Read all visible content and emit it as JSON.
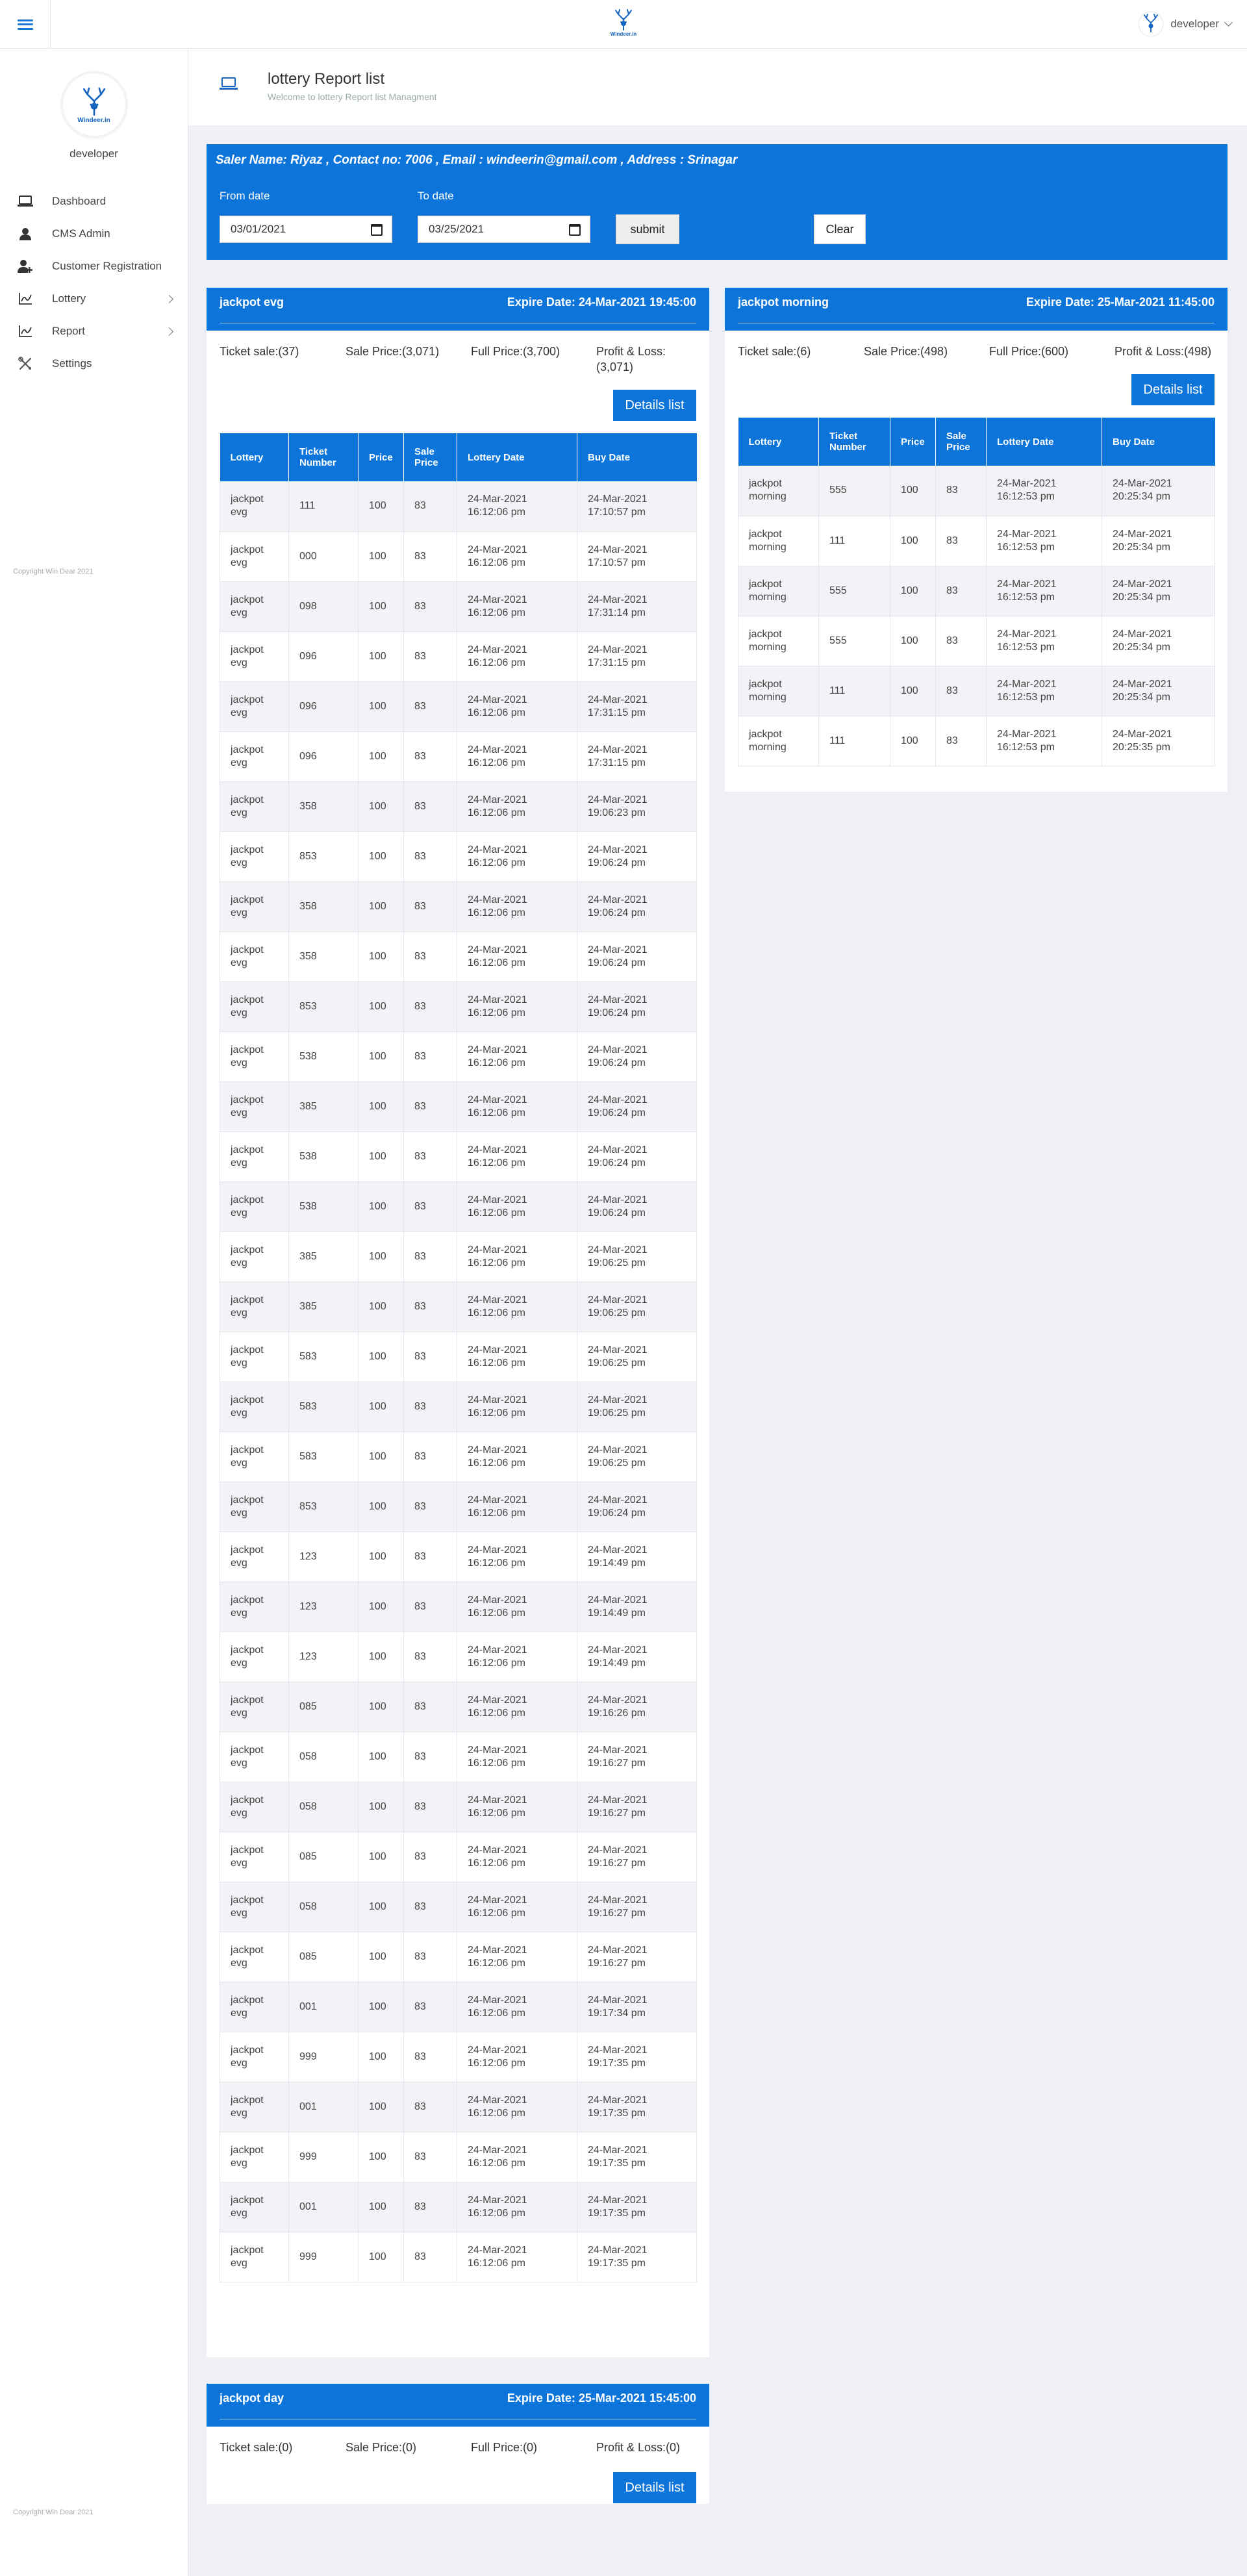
{
  "topbar": {
    "logo_text": "Windeer.in",
    "user_name": "developer"
  },
  "sidebar": {
    "logo_text": "Windeer.in",
    "profile_name": "developer",
    "items": [
      {
        "label": "Dashboard",
        "icon": "laptop-icon"
      },
      {
        "label": "CMS Admin",
        "icon": "user-icon"
      },
      {
        "label": "Customer Registration",
        "icon": "user-add-icon"
      },
      {
        "label": "Lottery",
        "icon": "chart-icon",
        "has_submenu": true
      },
      {
        "label": "Report",
        "icon": "chart-icon",
        "has_submenu": true
      },
      {
        "label": "Settings",
        "icon": "tools-icon"
      }
    ],
    "copyright": "Copyright Win Dear 2021"
  },
  "header": {
    "title": "lottery Report list",
    "subtitle": "Welcome to lottery Report list Managment"
  },
  "filter": {
    "saler_info": "Saler Name: Riyaz , Contact no: 7006 , Email : windeerin@gmail.com , Address : Srinagar",
    "from_label": "From date",
    "from_value": "03/01/2021",
    "to_label": "To date",
    "to_value": "03/25/2021",
    "submit_label": "submit",
    "clear_label": "Clear"
  },
  "table_headers": [
    "Lottery",
    "Ticket Number",
    "Price",
    "Sale Price",
    "Lottery Date",
    "Buy Date"
  ],
  "details_label": "Details list",
  "cards": [
    {
      "name": "jackpot evg",
      "expire": "Expire Date: 24-Mar-2021 19:45:00",
      "ticket_sale": "Ticket sale:(37)",
      "sale_price": "Sale Price:(3,071)",
      "full_price": "Full Price:(3,700)",
      "profit_loss": "Profit & Loss:(3,071)",
      "rows": [
        [
          "jackpot evg",
          "111",
          "100",
          "83",
          "24-Mar-2021 16:12:06 pm",
          "24-Mar-2021 17:10:57 pm"
        ],
        [
          "jackpot evg",
          "000",
          "100",
          "83",
          "24-Mar-2021 16:12:06 pm",
          "24-Mar-2021 17:10:57 pm"
        ],
        [
          "jackpot evg",
          "098",
          "100",
          "83",
          "24-Mar-2021 16:12:06 pm",
          "24-Mar-2021 17:31:14 pm"
        ],
        [
          "jackpot evg",
          "096",
          "100",
          "83",
          "24-Mar-2021 16:12:06 pm",
          "24-Mar-2021 17:31:15 pm"
        ],
        [
          "jackpot evg",
          "096",
          "100",
          "83",
          "24-Mar-2021 16:12:06 pm",
          "24-Mar-2021 17:31:15 pm"
        ],
        [
          "jackpot evg",
          "096",
          "100",
          "83",
          "24-Mar-2021 16:12:06 pm",
          "24-Mar-2021 17:31:15 pm"
        ],
        [
          "jackpot evg",
          "358",
          "100",
          "83",
          "24-Mar-2021 16:12:06 pm",
          "24-Mar-2021 19:06:23 pm"
        ],
        [
          "jackpot evg",
          "853",
          "100",
          "83",
          "24-Mar-2021 16:12:06 pm",
          "24-Mar-2021 19:06:24 pm"
        ],
        [
          "jackpot evg",
          "358",
          "100",
          "83",
          "24-Mar-2021 16:12:06 pm",
          "24-Mar-2021 19:06:24 pm"
        ],
        [
          "jackpot evg",
          "358",
          "100",
          "83",
          "24-Mar-2021 16:12:06 pm",
          "24-Mar-2021 19:06:24 pm"
        ],
        [
          "jackpot evg",
          "853",
          "100",
          "83",
          "24-Mar-2021 16:12:06 pm",
          "24-Mar-2021 19:06:24 pm"
        ],
        [
          "jackpot evg",
          "538",
          "100",
          "83",
          "24-Mar-2021 16:12:06 pm",
          "24-Mar-2021 19:06:24 pm"
        ],
        [
          "jackpot evg",
          "385",
          "100",
          "83",
          "24-Mar-2021 16:12:06 pm",
          "24-Mar-2021 19:06:24 pm"
        ],
        [
          "jackpot evg",
          "538",
          "100",
          "83",
          "24-Mar-2021 16:12:06 pm",
          "24-Mar-2021 19:06:24 pm"
        ],
        [
          "jackpot evg",
          "538",
          "100",
          "83",
          "24-Mar-2021 16:12:06 pm",
          "24-Mar-2021 19:06:24 pm"
        ],
        [
          "jackpot evg",
          "385",
          "100",
          "83",
          "24-Mar-2021 16:12:06 pm",
          "24-Mar-2021 19:06:25 pm"
        ],
        [
          "jackpot evg",
          "385",
          "100",
          "83",
          "24-Mar-2021 16:12:06 pm",
          "24-Mar-2021 19:06:25 pm"
        ],
        [
          "jackpot evg",
          "583",
          "100",
          "83",
          "24-Mar-2021 16:12:06 pm",
          "24-Mar-2021 19:06:25 pm"
        ],
        [
          "jackpot evg",
          "583",
          "100",
          "83",
          "24-Mar-2021 16:12:06 pm",
          "24-Mar-2021 19:06:25 pm"
        ],
        [
          "jackpot evg",
          "583",
          "100",
          "83",
          "24-Mar-2021 16:12:06 pm",
          "24-Mar-2021 19:06:25 pm"
        ],
        [
          "jackpot evg",
          "853",
          "100",
          "83",
          "24-Mar-2021 16:12:06 pm",
          "24-Mar-2021 19:06:24 pm"
        ],
        [
          "jackpot evg",
          "123",
          "100",
          "83",
          "24-Mar-2021 16:12:06 pm",
          "24-Mar-2021 19:14:49 pm"
        ],
        [
          "jackpot evg",
          "123",
          "100",
          "83",
          "24-Mar-2021 16:12:06 pm",
          "24-Mar-2021 19:14:49 pm"
        ],
        [
          "jackpot evg",
          "123",
          "100",
          "83",
          "24-Mar-2021 16:12:06 pm",
          "24-Mar-2021 19:14:49 pm"
        ],
        [
          "jackpot evg",
          "085",
          "100",
          "83",
          "24-Mar-2021 16:12:06 pm",
          "24-Mar-2021 19:16:26 pm"
        ],
        [
          "jackpot evg",
          "058",
          "100",
          "83",
          "24-Mar-2021 16:12:06 pm",
          "24-Mar-2021 19:16:27 pm"
        ],
        [
          "jackpot evg",
          "058",
          "100",
          "83",
          "24-Mar-2021 16:12:06 pm",
          "24-Mar-2021 19:16:27 pm"
        ],
        [
          "jackpot evg",
          "085",
          "100",
          "83",
          "24-Mar-2021 16:12:06 pm",
          "24-Mar-2021 19:16:27 pm"
        ],
        [
          "jackpot evg",
          "058",
          "100",
          "83",
          "24-Mar-2021 16:12:06 pm",
          "24-Mar-2021 19:16:27 pm"
        ],
        [
          "jackpot evg",
          "085",
          "100",
          "83",
          "24-Mar-2021 16:12:06 pm",
          "24-Mar-2021 19:16:27 pm"
        ],
        [
          "jackpot evg",
          "001",
          "100",
          "83",
          "24-Mar-2021 16:12:06 pm",
          "24-Mar-2021 19:17:34 pm"
        ],
        [
          "jackpot evg",
          "999",
          "100",
          "83",
          "24-Mar-2021 16:12:06 pm",
          "24-Mar-2021 19:17:35 pm"
        ],
        [
          "jackpot evg",
          "001",
          "100",
          "83",
          "24-Mar-2021 16:12:06 pm",
          "24-Mar-2021 19:17:35 pm"
        ],
        [
          "jackpot evg",
          "999",
          "100",
          "83",
          "24-Mar-2021 16:12:06 pm",
          "24-Mar-2021 19:17:35 pm"
        ],
        [
          "jackpot evg",
          "001",
          "100",
          "83",
          "24-Mar-2021 16:12:06 pm",
          "24-Mar-2021 19:17:35 pm"
        ],
        [
          "jackpot evg",
          "999",
          "100",
          "83",
          "24-Mar-2021 16:12:06 pm",
          "24-Mar-2021 19:17:35 pm"
        ]
      ]
    },
    {
      "name": "jackpot morning",
      "expire": "Expire Date: 25-Mar-2021 11:45:00",
      "ticket_sale": "Ticket sale:(6)",
      "sale_price": "Sale Price:(498)",
      "full_price": "Full Price:(600)",
      "profit_loss": "Profit & Loss:(498)",
      "rows": [
        [
          "jackpot morning",
          "555",
          "100",
          "83",
          "24-Mar-2021 16:12:53 pm",
          "24-Mar-2021 20:25:34 pm"
        ],
        [
          "jackpot morning",
          "111",
          "100",
          "83",
          "24-Mar-2021 16:12:53 pm",
          "24-Mar-2021 20:25:34 pm"
        ],
        [
          "jackpot morning",
          "555",
          "100",
          "83",
          "24-Mar-2021 16:12:53 pm",
          "24-Mar-2021 20:25:34 pm"
        ],
        [
          "jackpot morning",
          "555",
          "100",
          "83",
          "24-Mar-2021 16:12:53 pm",
          "24-Mar-2021 20:25:34 pm"
        ],
        [
          "jackpot morning",
          "111",
          "100",
          "83",
          "24-Mar-2021 16:12:53 pm",
          "24-Mar-2021 20:25:34 pm"
        ],
        [
          "jackpot morning",
          "111",
          "100",
          "83",
          "24-Mar-2021 16:12:53 pm",
          "24-Mar-2021 20:25:35 pm"
        ]
      ]
    },
    {
      "name": "jackpot day",
      "expire": "Expire Date: 25-Mar-2021 15:45:00",
      "ticket_sale": "Ticket sale:(0)",
      "sale_price": "Sale Price:(0)",
      "full_price": "Full Price:(0)",
      "profit_loss": "Profit & Loss:(0)",
      "rows": []
    }
  ],
  "colors": {
    "primary": "#0d74d9",
    "background": "#eef0f5"
  }
}
